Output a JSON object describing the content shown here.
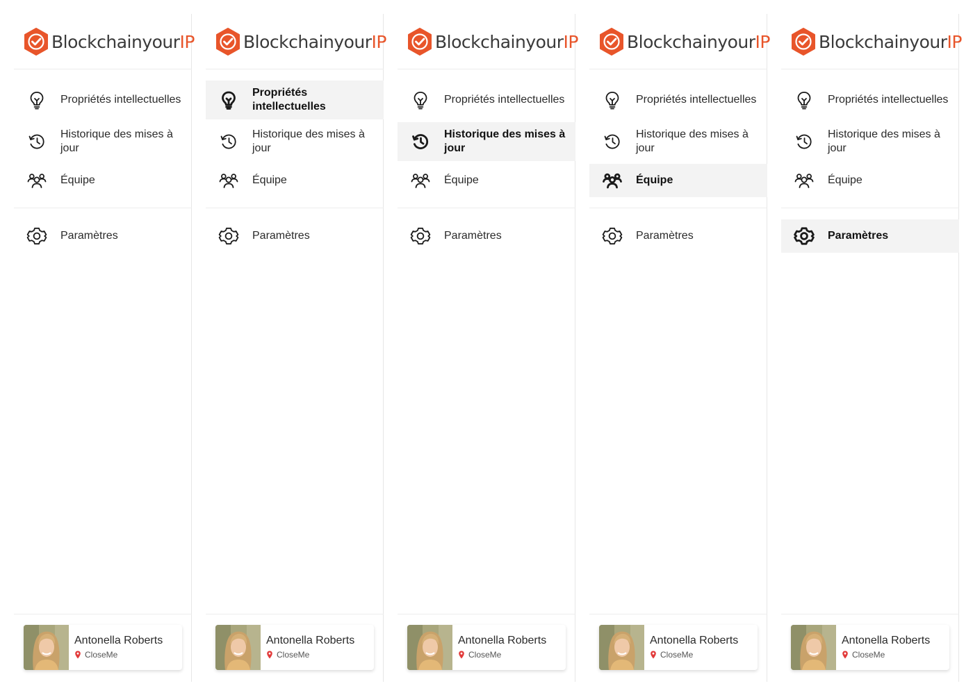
{
  "brand": {
    "name_main": "Blockchainyour",
    "name_accent": "IP",
    "accent_color": "#e8552a"
  },
  "nav": {
    "items": [
      {
        "key": "ip",
        "label": "Propriétés intellectuelles",
        "icon": "lightbulb-icon"
      },
      {
        "key": "history",
        "label": "Historique des mises à jour",
        "icon": "history-icon"
      },
      {
        "key": "team",
        "label": "Équipe",
        "icon": "team-icon"
      }
    ],
    "settings": {
      "key": "settings",
      "label": "Paramètres",
      "icon": "gear-icon"
    }
  },
  "user": {
    "name": "Antonella Roberts",
    "org": "CloseMe"
  },
  "panels": [
    {
      "active": "none"
    },
    {
      "active": "ip"
    },
    {
      "active": "history"
    },
    {
      "active": "team"
    },
    {
      "active": "settings"
    }
  ]
}
